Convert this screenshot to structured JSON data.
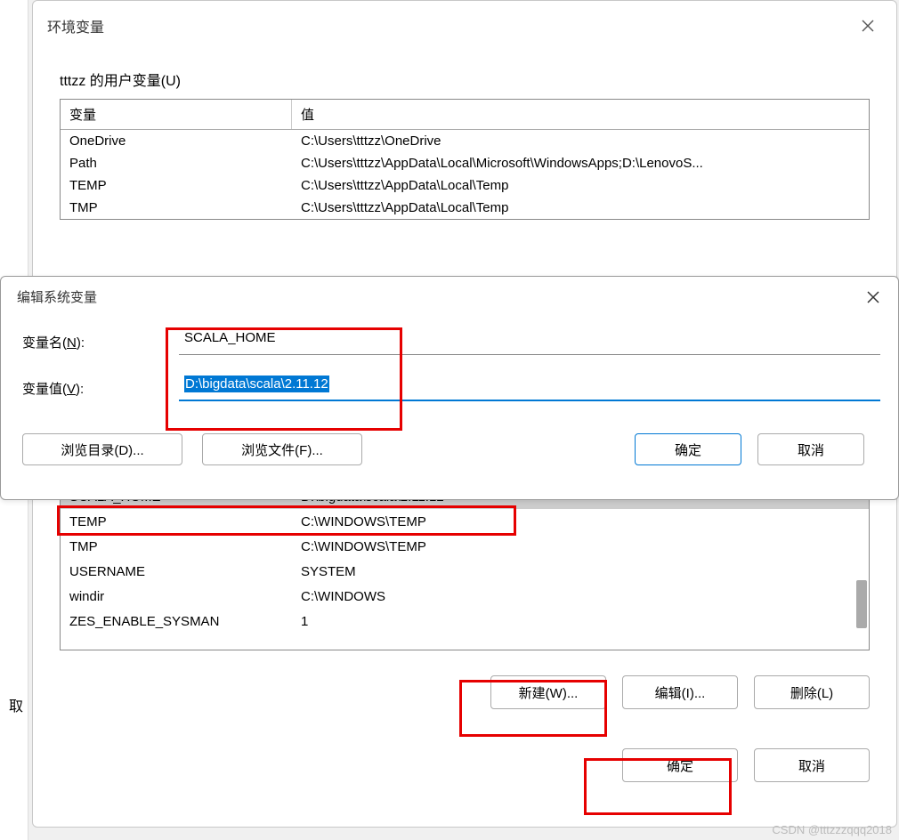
{
  "bg_partial": "取",
  "env_dialog": {
    "title": "环境变量",
    "user_section_label": "tttzz 的用户变量(U)",
    "col_var": "变量",
    "col_val": "值",
    "user_rows": [
      {
        "var": "OneDrive",
        "val": "C:\\Users\\tttzz\\OneDrive"
      },
      {
        "var": "Path",
        "val": "C:\\Users\\tttzz\\AppData\\Local\\Microsoft\\WindowsApps;D:\\LenovoS..."
      },
      {
        "var": "TEMP",
        "val": "C:\\Users\\tttzz\\AppData\\Local\\Temp"
      },
      {
        "var": "TMP",
        "val": "C:\\Users\\tttzz\\AppData\\Local\\Temp"
      }
    ],
    "sys_rows": [
      {
        "var": "SCALA_HOME",
        "val": "D:\\bigdata\\scala\\2.11.12",
        "selected": true
      },
      {
        "var": "TEMP",
        "val": "C:\\WINDOWS\\TEMP"
      },
      {
        "var": "TMP",
        "val": "C:\\WINDOWS\\TEMP"
      },
      {
        "var": "USERNAME",
        "val": "SYSTEM"
      },
      {
        "var": "windir",
        "val": "C:\\WINDOWS"
      },
      {
        "var": "ZES_ENABLE_SYSMAN",
        "val": "1"
      }
    ],
    "btn_new": "新建(W)...",
    "btn_edit": "编辑(I)...",
    "btn_delete": "删除(L)",
    "btn_ok": "确定",
    "btn_cancel": "取消"
  },
  "edit_dialog": {
    "title": "编辑系统变量",
    "name_label_prefix": "变量名(",
    "name_label_accel": "N",
    "name_label_suffix": "):",
    "name_value": "SCALA_HOME",
    "value_label_prefix": "变量值(",
    "value_label_accel": "V",
    "value_label_suffix": "):",
    "value_value": "D:\\bigdata\\scala\\2.11.12",
    "btn_browse_dir": "浏览目录(D)...",
    "btn_browse_file": "浏览文件(F)...",
    "btn_ok": "确定",
    "btn_cancel": "取消"
  },
  "watermark": "CSDN @tttzzzqqq2018"
}
